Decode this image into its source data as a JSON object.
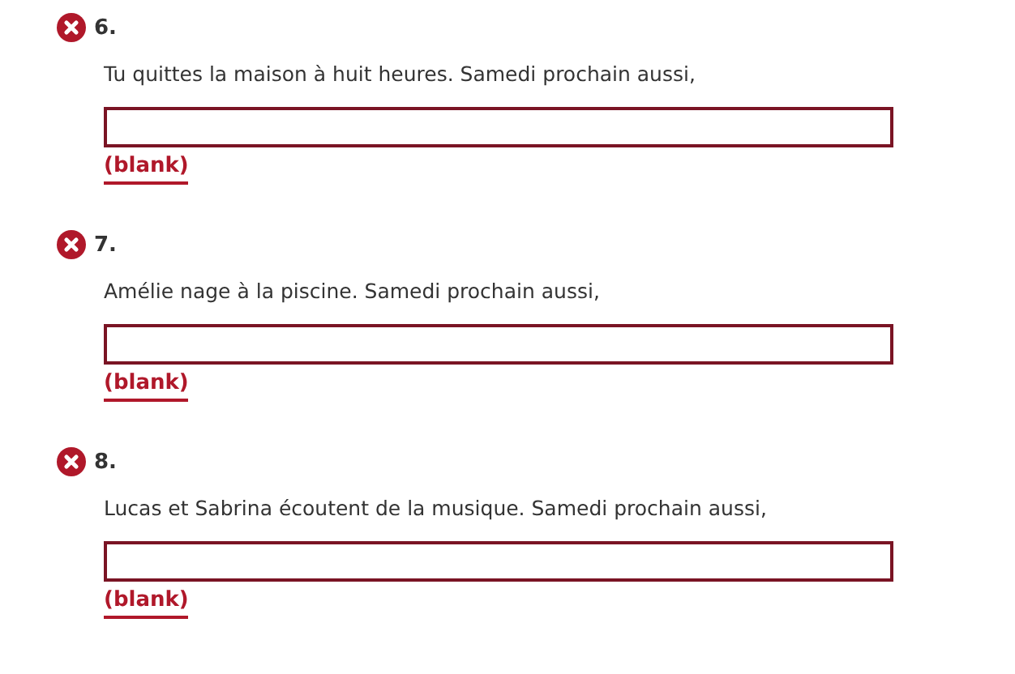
{
  "questions": [
    {
      "number": "6.",
      "correct": false,
      "prompt": "Tu quittes la maison à huit heures. Samedi prochain aussi,",
      "answer": "(blank)"
    },
    {
      "number": "7.",
      "correct": false,
      "prompt": "Amélie nage à la piscine. Samedi prochain aussi,",
      "answer": "(blank)"
    },
    {
      "number": "8.",
      "correct": false,
      "prompt": "Lucas et Sabrina écoutent de la musique. Samedi prochain aussi,",
      "answer": "(blank)"
    }
  ]
}
